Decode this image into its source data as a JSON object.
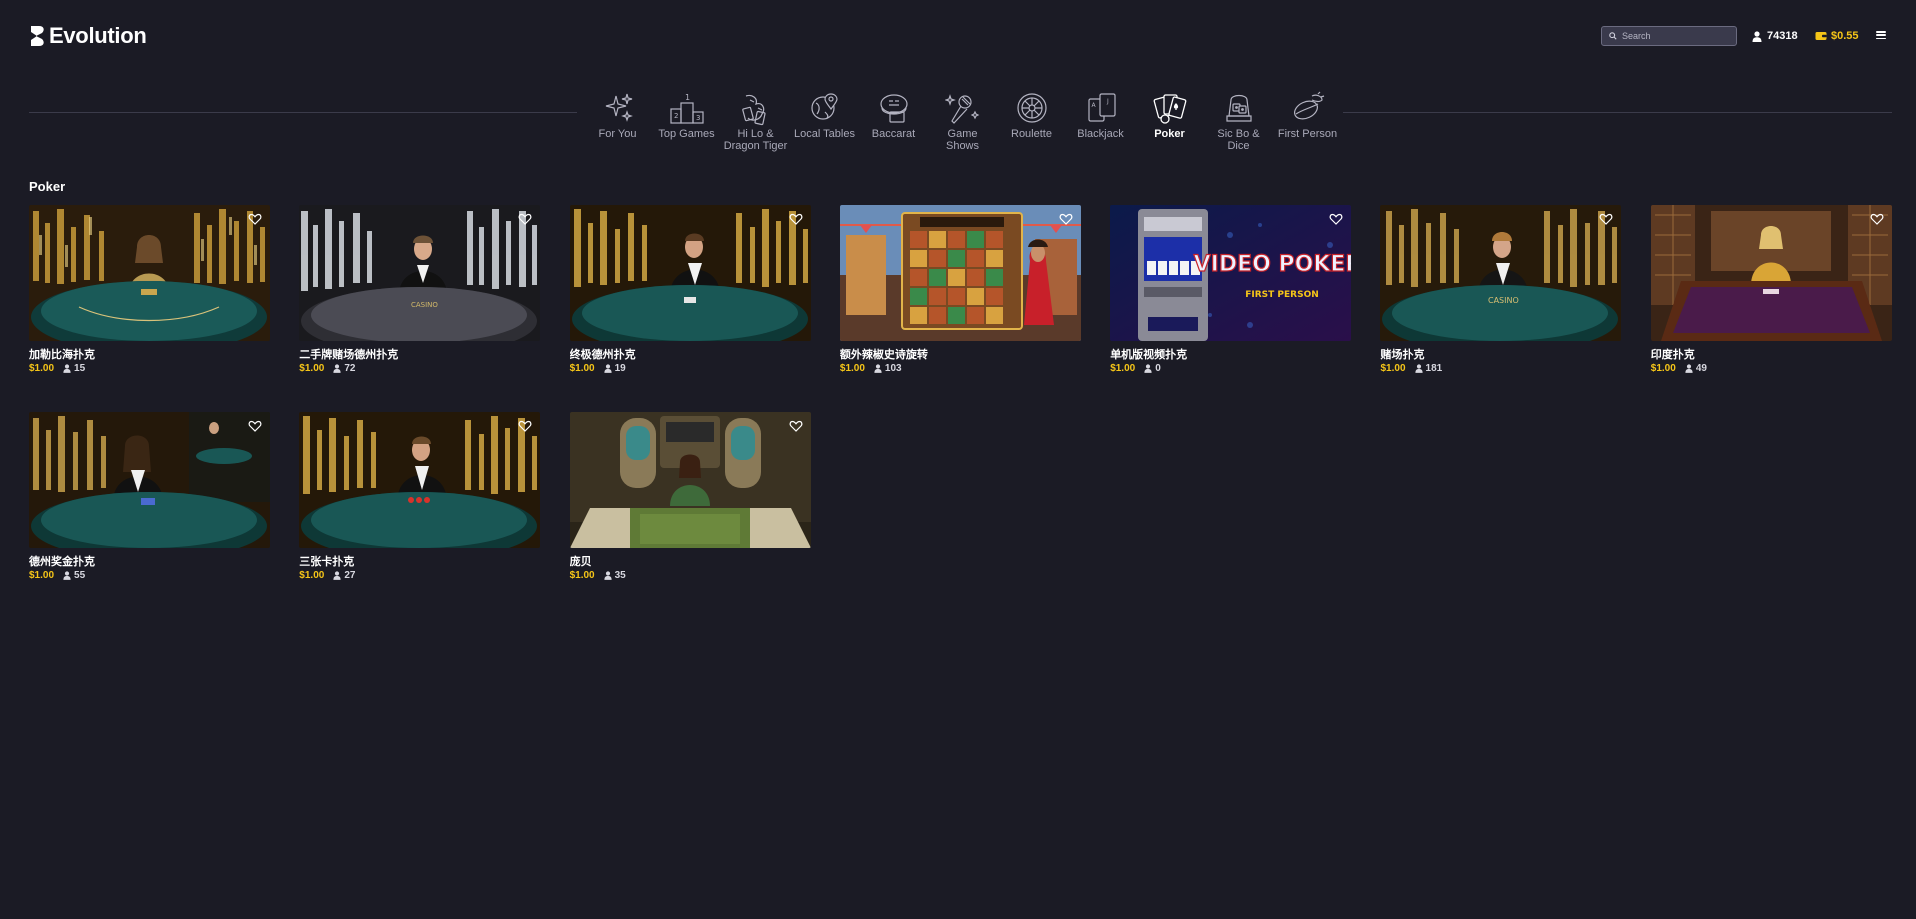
{
  "header": {
    "logo_text": "Evolution",
    "search_placeholder": "Search",
    "players_count": "74318",
    "balance": "$0.55",
    "icons": {
      "search": "search-icon",
      "players": "user-icon",
      "balance": "wallet-icon",
      "menu": "hamburger-menu-icon"
    },
    "colors": {
      "accent": "#f5c518",
      "background": "#1b1b25"
    }
  },
  "nav": {
    "items": [
      {
        "label": "For You",
        "icon": "sparkles-icon"
      },
      {
        "label": "Top Games",
        "icon": "podium-icon"
      },
      {
        "label": "Hi Lo & Dragon Tiger",
        "icon": "dragon-tiger-icon"
      },
      {
        "label": "Local Tables",
        "icon": "globe-pin-icon"
      },
      {
        "label": "Baccarat",
        "icon": "baccarat-icon"
      },
      {
        "label": "Game Shows",
        "icon": "microphone-icon"
      },
      {
        "label": "Roulette",
        "icon": "roulette-wheel-icon"
      },
      {
        "label": "Blackjack",
        "icon": "cards-icon"
      },
      {
        "label": "Poker",
        "icon": "poker-cards-icon",
        "active": true
      },
      {
        "label": "Sic Bo & Dice",
        "icon": "dice-icon"
      },
      {
        "label": "First Person",
        "icon": "first-person-icon"
      }
    ]
  },
  "section": {
    "title": "Poker",
    "games": [
      {
        "name": "加勒比海扑克",
        "price": "$1.00",
        "users": "15",
        "theme": "gold-dealer"
      },
      {
        "name": "二手牌赌场德州扑克",
        "price": "$1.00",
        "users": "72",
        "theme": "silver-dealer"
      },
      {
        "name": "终极德州扑克",
        "price": "$1.00",
        "users": "19",
        "theme": "gold-dealer"
      },
      {
        "name": "额外辣椒史诗旋转",
        "price": "$1.00",
        "users": "103",
        "theme": "slot"
      },
      {
        "name": "单机版视频扑克",
        "price": "$1.00",
        "users": "0",
        "theme": "video-poker"
      },
      {
        "name": "赌场扑克",
        "price": "$1.00",
        "users": "181",
        "theme": "gold-dealer"
      },
      {
        "name": "印度扑克",
        "price": "$1.00",
        "users": "49",
        "theme": "purple-table"
      },
      {
        "name": "德州奖金扑克",
        "price": "$1.00",
        "users": "55",
        "theme": "gold-dealer"
      },
      {
        "name": "三张卡扑克",
        "price": "$1.00",
        "users": "27",
        "theme": "gold-dealer"
      },
      {
        "name": "庞贝",
        "price": "$1.00",
        "users": "35",
        "theme": "green-studio"
      }
    ],
    "thumbnail_overlays": {
      "video_poker_title": "VIDEO POKER",
      "video_poker_sub": "FIRST PERSON"
    }
  }
}
